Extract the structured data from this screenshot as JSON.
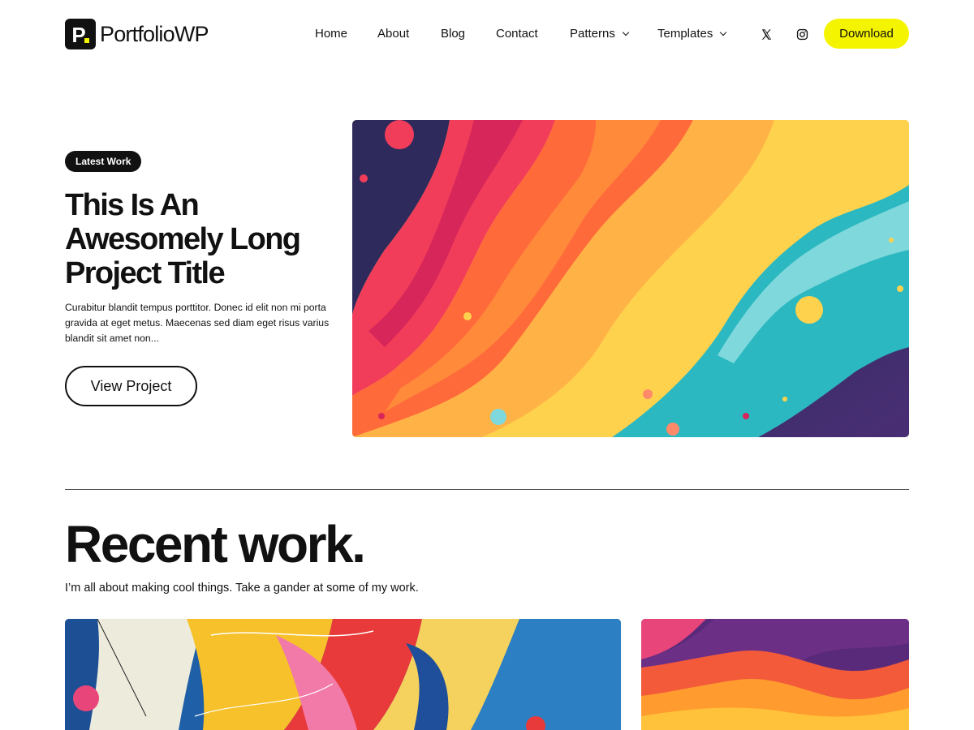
{
  "brand": {
    "logo_letter": "P",
    "name": "PortfolioWP",
    "accent": "#f5f400"
  },
  "nav": {
    "items": [
      {
        "label": "Home"
      },
      {
        "label": "About"
      },
      {
        "label": "Blog"
      },
      {
        "label": "Contact"
      },
      {
        "label": "Patterns",
        "dropdown": true
      },
      {
        "label": "Templates",
        "dropdown": true
      }
    ],
    "social": [
      "x-icon",
      "instagram-icon"
    ],
    "download_label": "Download"
  },
  "hero": {
    "badge": "Latest Work",
    "title": "This Is An Awesomely Long Project Title",
    "description": "Curabitur blandit tempus porttitor. Donec id elit non mi porta gravida at eget metus. Maecenas sed diam eget risus varius blandit sit amet non...",
    "button_label": "View Project"
  },
  "recent": {
    "title": "Recent work.",
    "subtitle": "I’m all about making cool things. Take a gander at some of my work."
  }
}
